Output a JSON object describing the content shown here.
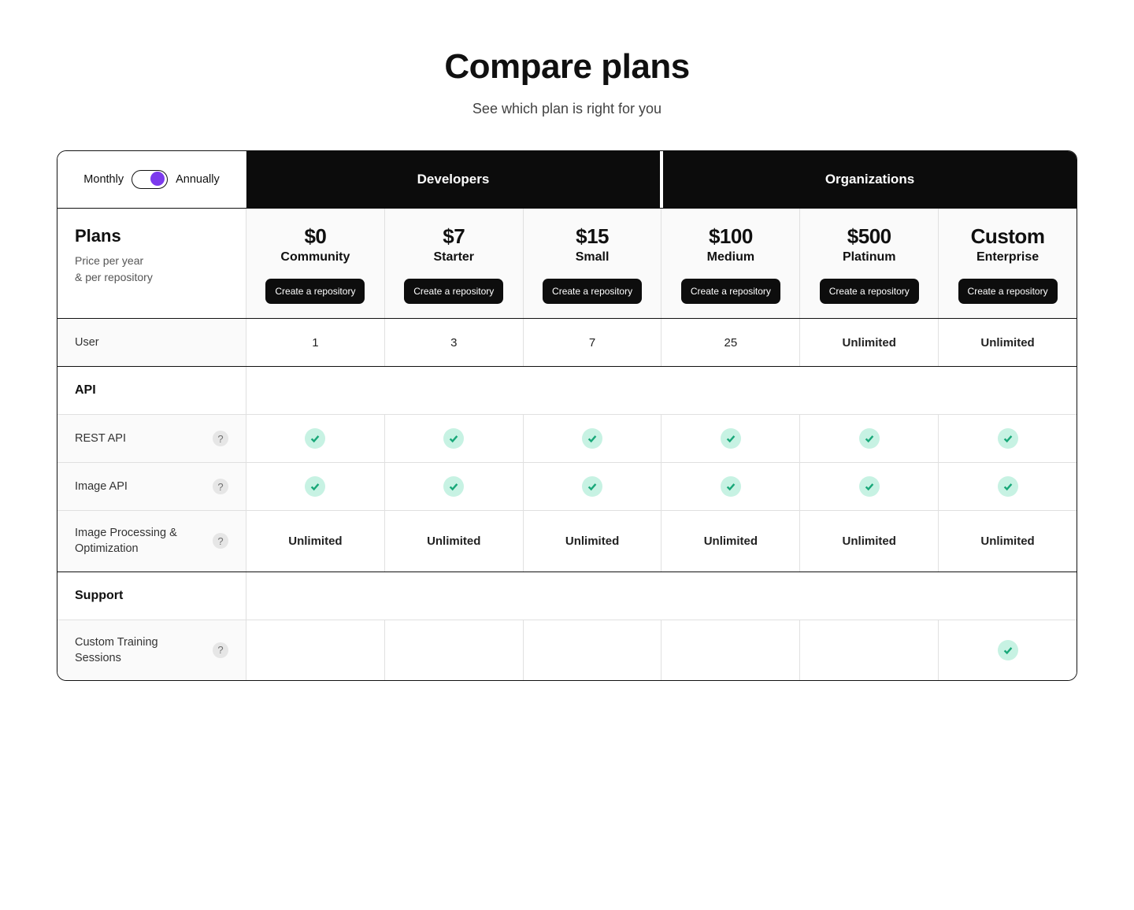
{
  "header": {
    "title": "Compare plans",
    "subtitle": "See which plan is right for you"
  },
  "billing_toggle": {
    "left": "Monthly",
    "right": "Annually",
    "selected": "Annually"
  },
  "groups": {
    "developers": "Developers",
    "organizations": "Organizations"
  },
  "label_col": {
    "plans": "Plans",
    "sub1": "Price per year",
    "sub2": "& per repository"
  },
  "cta": "Create a repository",
  "plans": [
    {
      "price": "$0",
      "name": "Community",
      "group": "dev"
    },
    {
      "price": "$7",
      "name": "Starter",
      "group": "dev"
    },
    {
      "price": "$15",
      "name": "Small",
      "group": "dev"
    },
    {
      "price": "$100",
      "name": "Medium",
      "group": "org"
    },
    {
      "price": "$500",
      "name": "Platinum",
      "group": "org"
    },
    {
      "price": "Custom",
      "name": "Enterprise",
      "group": "org"
    }
  ],
  "rows": {
    "user": {
      "label": "User",
      "values": [
        "1",
        "3",
        "7",
        "25",
        "Unlimited",
        "Unlimited"
      ],
      "strong": [
        false,
        false,
        false,
        false,
        true,
        true
      ]
    }
  },
  "api_section": "API",
  "api_rows": {
    "rest": {
      "label": "REST API",
      "checks": [
        true,
        true,
        true,
        true,
        true,
        true
      ]
    },
    "image": {
      "label": "Image API",
      "checks": [
        true,
        true,
        true,
        true,
        true,
        true
      ]
    },
    "opt": {
      "label": "Image Processing & Optimization",
      "values": [
        "Unlimited",
        "Unlimited",
        "Unlimited",
        "Unlimited",
        "Unlimited",
        "Unlimited"
      ]
    }
  },
  "support_section": "Support",
  "support_rows": {
    "training": {
      "label": "Custom Training Sessions",
      "checks": [
        false,
        false,
        false,
        false,
        false,
        true
      ]
    }
  }
}
